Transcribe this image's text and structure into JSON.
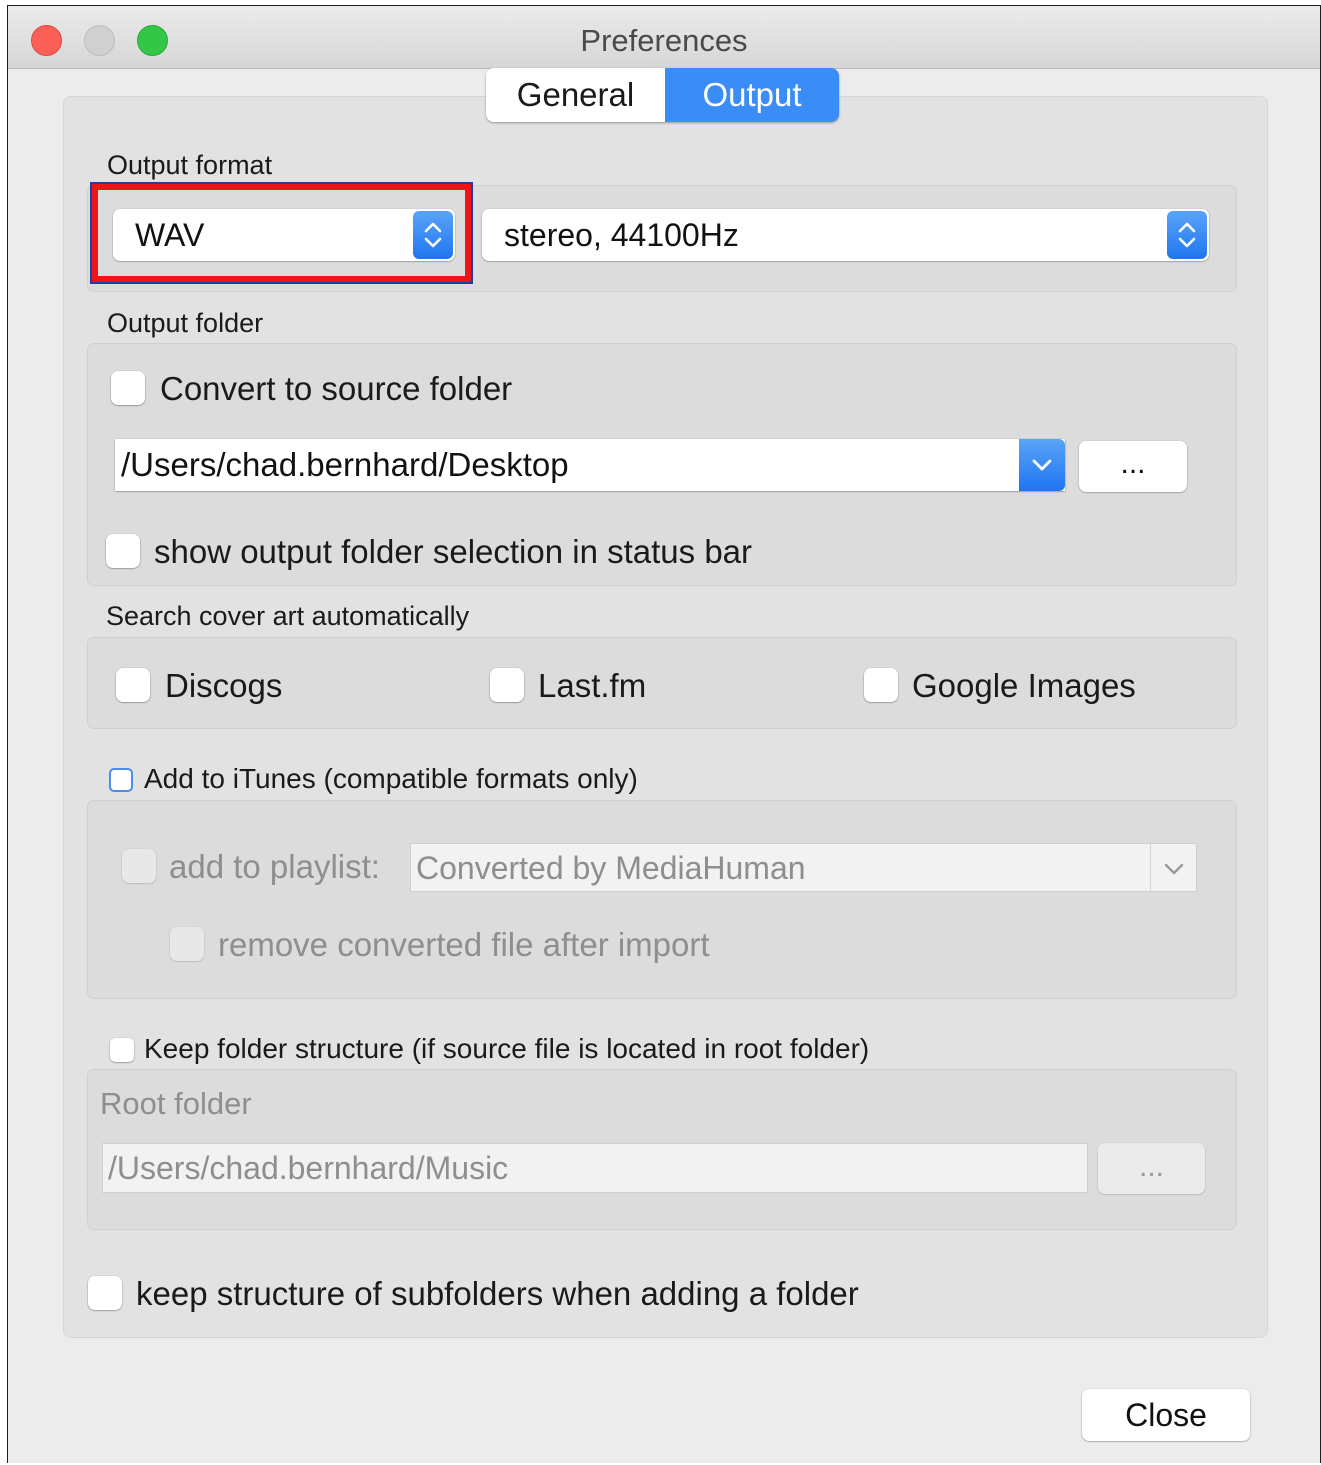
{
  "window": {
    "title": "Preferences"
  },
  "tabs": [
    {
      "label": "General",
      "selected": false
    },
    {
      "label": "Output",
      "selected": true
    }
  ],
  "output_format": {
    "label": "Output format",
    "format_value": "WAV",
    "channels_value": "stereo, 44100Hz"
  },
  "output_folder": {
    "label": "Output folder",
    "convert_to_source_label": "Convert to source folder",
    "convert_to_source_checked": false,
    "path": "/Users/chad.bernhard/Desktop",
    "browse_label": "...",
    "show_in_status_bar_label": "show output folder selection in status bar",
    "show_in_status_bar_checked": false
  },
  "cover_art": {
    "label": "Search cover art automatically",
    "options": [
      {
        "label": "Discogs",
        "checked": false
      },
      {
        "label": "Last.fm",
        "checked": false
      },
      {
        "label": "Google Images",
        "checked": false
      }
    ]
  },
  "itunes": {
    "label": "Add to iTunes (compatible formats only)",
    "checked": false,
    "playlist_label": "add to playlist:",
    "playlist_value": "Converted by MediaHuman",
    "remove_after_import_label": "remove converted file after import"
  },
  "folder_structure": {
    "label": "Keep folder structure (if source file is located in root folder)",
    "checked": false,
    "root_folder_label": "Root folder",
    "root_folder_path": "/Users/chad.bernhard/Music",
    "browse_label": "..."
  },
  "subfolders": {
    "label": "keep structure of subfolders when adding a folder",
    "checked": false
  },
  "close_label": "Close",
  "colors": {
    "accent": "#3a8cf6",
    "highlight_border": "#f01418",
    "close_light": "#fc5f57",
    "minimize_light_inactive": "#d0d0d0",
    "zoom_light": "#33c748"
  }
}
